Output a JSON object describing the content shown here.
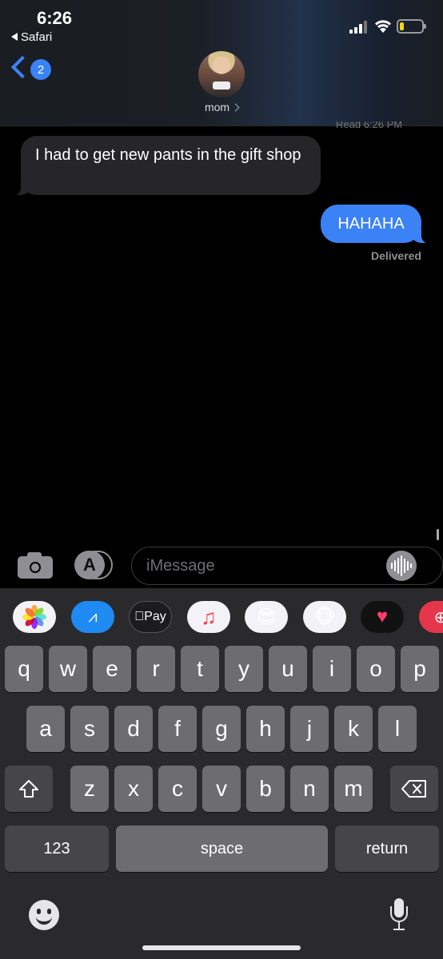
{
  "status_bar": {
    "time": "6:26",
    "back_app": "Safari"
  },
  "header": {
    "back_badge": "2",
    "contact_name": "mom",
    "read_receipt_peek": "Read 6:26 PM"
  },
  "messages": [
    {
      "direction": "incoming",
      "text": "I had to get new pants in the  gift shop"
    },
    {
      "direction": "outgoing",
      "text": "HAHAHA"
    }
  ],
  "delivery_status": "Delivered",
  "input": {
    "placeholder": "iMessage"
  },
  "app_strip": [
    {
      "name": "photos",
      "icon": "photos-icon"
    },
    {
      "name": "app-store",
      "icon": "app-store-icon"
    },
    {
      "name": "apple-pay",
      "label": "Pay",
      "icon": "apple-pay-icon"
    },
    {
      "name": "music",
      "icon": "music-note-icon"
    },
    {
      "name": "memoji",
      "icon": "memoji-icon"
    },
    {
      "name": "animoji",
      "icon": "monkey-icon"
    },
    {
      "name": "digital-touch",
      "icon": "heart-icon"
    },
    {
      "name": "web-images",
      "icon": "globe-icon"
    }
  ],
  "keyboard": {
    "row1": [
      "q",
      "w",
      "e",
      "r",
      "t",
      "y",
      "u",
      "i",
      "o",
      "p"
    ],
    "row2": [
      "a",
      "s",
      "d",
      "f",
      "g",
      "h",
      "j",
      "k",
      "l"
    ],
    "row3": [
      "z",
      "x",
      "c",
      "v",
      "b",
      "n",
      "m"
    ],
    "numbers_label": "123",
    "space_label": "space",
    "return_label": "return"
  },
  "colors": {
    "imessage_blue": "#3b82f6",
    "incoming_bubble": "#262628",
    "key": "#6d6d6f",
    "function_key": "#464648"
  }
}
